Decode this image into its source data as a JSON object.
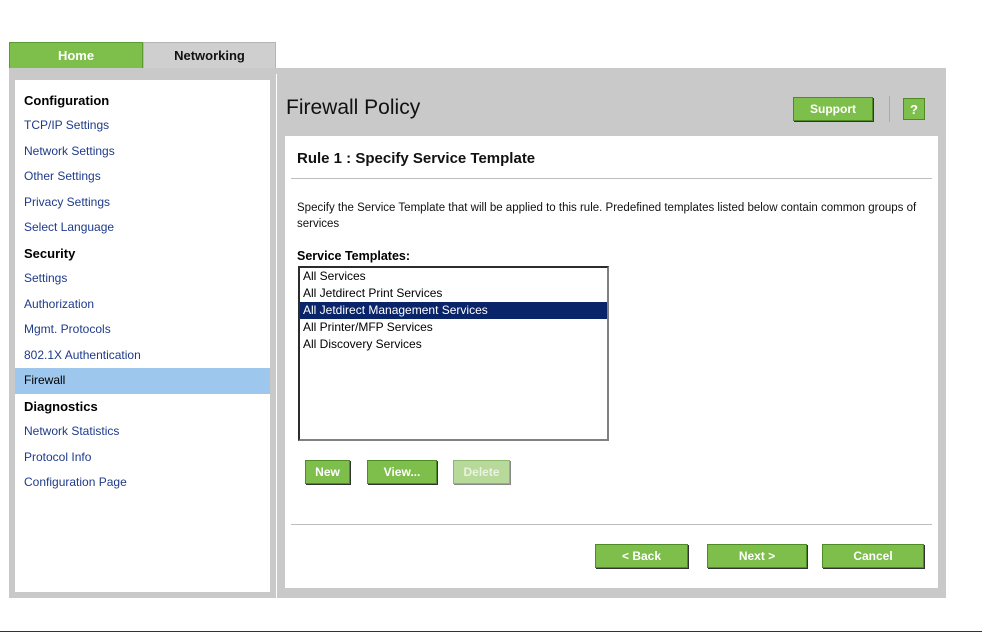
{
  "tabs": {
    "home": "Home",
    "networking": "Networking"
  },
  "sidebar": {
    "sections": [
      {
        "heading": "Configuration",
        "items": [
          "TCP/IP Settings",
          "Network Settings",
          "Other Settings",
          "Privacy Settings",
          "Select Language"
        ]
      },
      {
        "heading": "Security",
        "items": [
          "Settings",
          "Authorization",
          "Mgmt. Protocols",
          "802.1X Authentication",
          "Firewall"
        ]
      },
      {
        "heading": "Diagnostics",
        "items": [
          "Network Statistics",
          "Protocol Info",
          "Configuration Page"
        ]
      }
    ],
    "active_item": "Firewall"
  },
  "header": {
    "title": "Firewall Policy",
    "support_label": "Support",
    "help_label": "?"
  },
  "main": {
    "rule_heading": "Rule 1 : Specify Service Template",
    "description": "Specify the Service Template that will be applied to this rule. Predefined templates listed below contain common groups of services",
    "templates_label": "Service Templates:",
    "templates": [
      "All Services",
      "All Jetdirect Print Services",
      "All Jetdirect Management Services",
      "All Printer/MFP Services",
      "All Discovery Services"
    ],
    "selected_template": "All Jetdirect Management Services",
    "new_label": "New",
    "view_label": "View...",
    "delete_label": "Delete",
    "back_label": "< Back",
    "next_label": "Next >",
    "cancel_label": "Cancel"
  },
  "colors": {
    "accent_green": "#7dbf4a",
    "selection_blue": "#0a246a",
    "sidebar_active": "#9dc7ec",
    "frame_gray": "#c9c9c9"
  }
}
